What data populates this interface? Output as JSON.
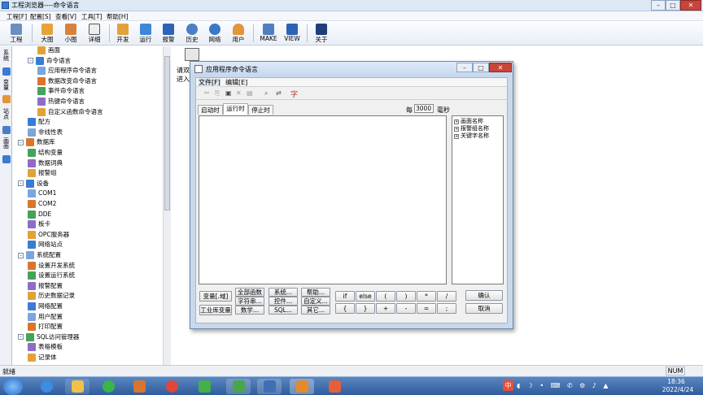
{
  "window": {
    "title": "工程浏览器----命令语言"
  },
  "menu": [
    "工程[F]",
    "配置[S]",
    "查看[V]",
    "工具[T]",
    "帮助[H]"
  ],
  "toolbar": [
    "工程",
    "大图",
    "小图",
    "详细",
    "开发",
    "运行",
    "报警",
    "历史",
    "网络",
    "用户",
    "MAKE",
    "VIEW",
    "关于"
  ],
  "left_tabs": [
    "系统",
    "变量",
    "站点",
    "画面"
  ],
  "tree": [
    {
      "label": "画面",
      "level": 2
    },
    {
      "label": "命令语言",
      "level": 1,
      "exp": "-"
    },
    {
      "label": "应用程序命令语言",
      "level": 2
    },
    {
      "label": "数据改变命令语言",
      "level": 2
    },
    {
      "label": "事件命令语言",
      "level": 2
    },
    {
      "label": "热键命令语言",
      "level": 2
    },
    {
      "label": "自定义函数命令语言",
      "level": 2
    },
    {
      "label": "配方",
      "level": 1
    },
    {
      "label": "非线性表",
      "level": 1
    },
    {
      "label": "数据库",
      "level": 0,
      "exp": "-"
    },
    {
      "label": "结构变量",
      "level": 1
    },
    {
      "label": "数据词典",
      "level": 1
    },
    {
      "label": "报警组",
      "level": 1
    },
    {
      "label": "设备",
      "level": 0,
      "exp": "-"
    },
    {
      "label": "COM1",
      "level": 1
    },
    {
      "label": "COM2",
      "level": 1
    },
    {
      "label": "DDE",
      "level": 1
    },
    {
      "label": "板卡",
      "level": 1
    },
    {
      "label": "OPC服务器",
      "level": 1
    },
    {
      "label": "网络站点",
      "level": 1
    },
    {
      "label": "系统配置",
      "level": 0,
      "exp": "-"
    },
    {
      "label": "设置开发系统",
      "level": 1
    },
    {
      "label": "设置运行系统",
      "level": 1
    },
    {
      "label": "报警配置",
      "level": 1
    },
    {
      "label": "历史数据记录",
      "level": 1
    },
    {
      "label": "网络配置",
      "level": 1
    },
    {
      "label": "用户配置",
      "level": 1
    },
    {
      "label": "打印配置",
      "level": 1
    },
    {
      "label": "SQL访问管理器",
      "level": 0,
      "exp": "-"
    },
    {
      "label": "表格模板",
      "level": 1
    },
    {
      "label": "记录体",
      "level": 1
    }
  ],
  "right_hint": {
    "line1": "请双",
    "line2": "进入"
  },
  "dialog": {
    "title": "应用程序命令语言",
    "menu": [
      "文件[F]",
      "编辑[E]"
    ],
    "tabs": [
      "启动时",
      "运行时",
      "停止时"
    ],
    "every_label": "每",
    "interval": "3000",
    "unit": "毫秒",
    "tree": [
      "画面名称",
      "报警组名称",
      "关键字名称"
    ],
    "left_buttons": [
      "变量[.域]",
      "工业库变量"
    ],
    "func_buttons": [
      "全部函数",
      "系统...",
      "帮助...",
      "字符串...",
      "控件...",
      "自定义...",
      "数学...",
      "SQL...",
      "其它..."
    ],
    "ops": [
      "if",
      "else",
      "(",
      ")",
      "*",
      "/",
      "{",
      "}",
      "+",
      "-",
      "=",
      ";"
    ],
    "ok": "确认",
    "cancel": "取消",
    "color_icon_glyph": "字"
  },
  "status": {
    "text": "就绪",
    "num": "NUM"
  },
  "clock": {
    "time": "18:36",
    "date": "2022/4/24"
  },
  "ime": {
    "indicator": "中"
  }
}
